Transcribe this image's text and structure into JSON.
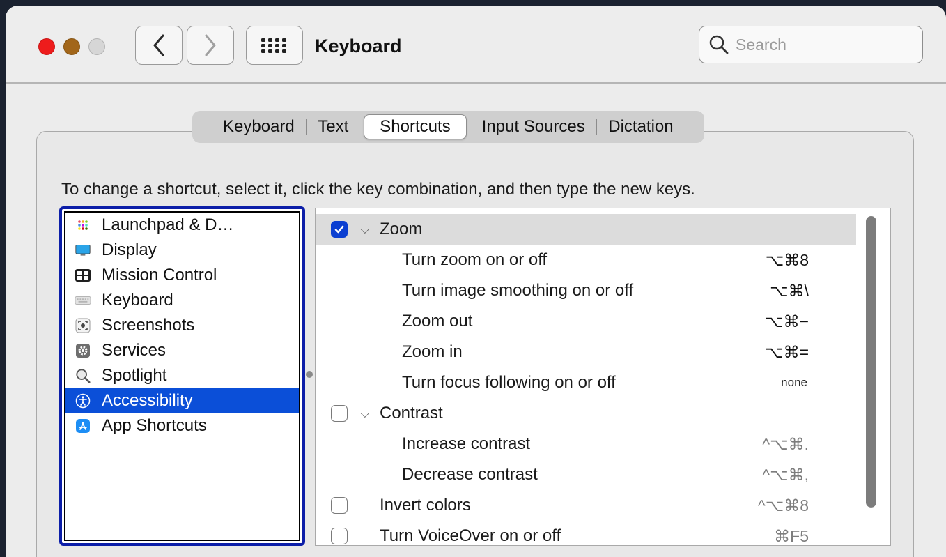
{
  "window": {
    "title": "Keyboard"
  },
  "search": {
    "placeholder": "Search"
  },
  "tabs": [
    "Keyboard",
    "Text",
    "Shortcuts",
    "Input Sources",
    "Dictation"
  ],
  "active_tab": "Shortcuts",
  "instruction": "To change a shortcut, select it, click the key combination, and then type the new keys.",
  "categories": [
    {
      "label": "Launchpad & D…",
      "icon": "launchpad-icon"
    },
    {
      "label": "Display",
      "icon": "display-icon"
    },
    {
      "label": "Mission Control",
      "icon": "mission-control-icon"
    },
    {
      "label": "Keyboard",
      "icon": "keyboard-icon"
    },
    {
      "label": "Screenshots",
      "icon": "screenshots-icon"
    },
    {
      "label": "Services",
      "icon": "services-gear-icon"
    },
    {
      "label": "Spotlight",
      "icon": "spotlight-magnifier-icon"
    },
    {
      "label": "Accessibility",
      "icon": "accessibility-icon",
      "selected": true
    },
    {
      "label": "App Shortcuts",
      "icon": "app-store-icon"
    }
  ],
  "shortcuts": [
    {
      "label": "Zoom",
      "checked": true,
      "group": true,
      "keys": ""
    },
    {
      "label": "Turn zoom on or off",
      "keys": "⌥⌘8"
    },
    {
      "label": "Turn image smoothing on or off",
      "keys": "⌥⌘\\"
    },
    {
      "label": "Zoom out",
      "keys": "⌥⌘−"
    },
    {
      "label": "Zoom in",
      "keys": "⌥⌘="
    },
    {
      "label": "Turn focus following on or off",
      "keys": "none"
    },
    {
      "label": "Contrast",
      "checked": false,
      "group": true,
      "keys": ""
    },
    {
      "label": "Increase contrast",
      "keys": "^⌥⌘."
    },
    {
      "label": "Decrease contrast",
      "keys": "^⌥⌘,"
    },
    {
      "label": "Invert colors",
      "checked": false,
      "keys": "^⌥⌘8"
    },
    {
      "label": "Turn VoiceOver on or off",
      "checked": false,
      "keys": "⌘F5"
    }
  ],
  "colors": {
    "selection": "#0b4fd8",
    "checkbox_on": "#0b3fd1",
    "focus_ring": "#0c1ea8"
  }
}
